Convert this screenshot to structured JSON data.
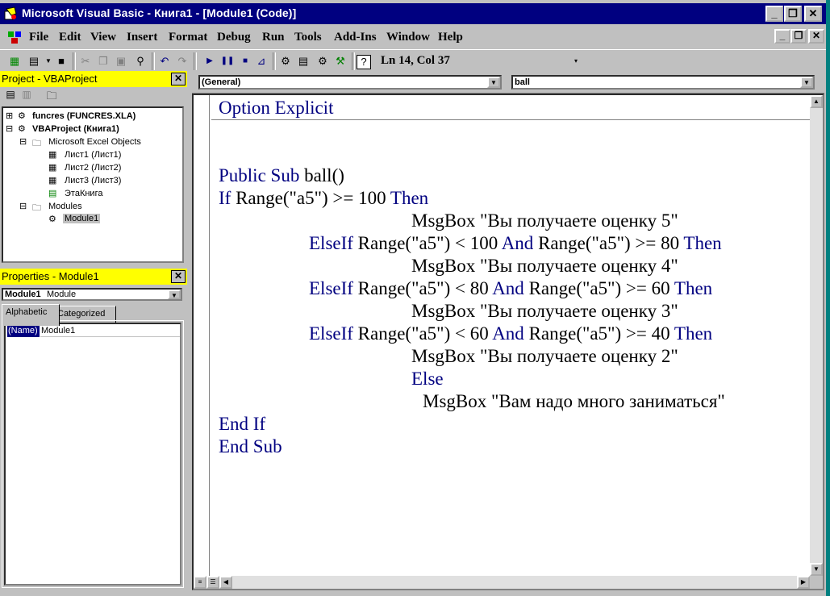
{
  "window": {
    "title": "Microsoft Visual Basic - Книга1 - [Module1 (Code)]"
  },
  "menu": [
    "File",
    "Edit",
    "View",
    "Insert",
    "Format",
    "Debug",
    "Run",
    "Tools",
    "Add-Ins",
    "Window",
    "Help"
  ],
  "toolbar": {
    "position": "Ln 14, Col 37"
  },
  "project_pane": {
    "title": "Project - VBAProject",
    "nodes": {
      "funcres": "funcres (FUNCRES.XLA)",
      "vbaproject": "VBAProject (Книга1)",
      "excel_objects": "Microsoft Excel Objects",
      "sheet1": "Лист1 (Лист1)",
      "sheet2": "Лист2 (Лист2)",
      "sheet3": "Лист3 (Лист3)",
      "thisbook": "ЭтаКнига",
      "modules": "Modules",
      "module1": "Module1"
    }
  },
  "properties_pane": {
    "title": "Properties - Module1",
    "object_name": "Module1",
    "object_type": "Module",
    "tabs": [
      "Alphabetic",
      "Categorized"
    ],
    "row": {
      "name": "(Name)",
      "value": "Module1"
    }
  },
  "editor": {
    "object_combo": "(General)",
    "proc_combo": "ball",
    "option_line": "Option Explicit",
    "lines": [
      {
        "indent": 0,
        "parts": [
          {
            "t": "Public Sub",
            "k": true
          },
          {
            "t": " ball()",
            "k": false
          }
        ]
      },
      {
        "indent": 0,
        "parts": [
          {
            "t": "If",
            "k": true
          },
          {
            "t": " Range(\"a5\") >= 100 ",
            "k": false
          },
          {
            "t": "Then",
            "k": true
          }
        ]
      },
      {
        "indent": 2,
        "parts": [
          {
            "t": "MsgBox \"Вы получаете оценку 5\"",
            "k": false
          }
        ]
      },
      {
        "indent": 1,
        "parts": [
          {
            "t": "ElseIf",
            "k": true
          },
          {
            "t": " Range(\"a5\") < 100 ",
            "k": false
          },
          {
            "t": "And",
            "k": true
          },
          {
            "t": " Range(\"a5\") >= 80 ",
            "k": false
          },
          {
            "t": "Then",
            "k": true
          }
        ]
      },
      {
        "indent": 2,
        "parts": [
          {
            "t": "MsgBox \"Вы получаете оценку 4\"",
            "k": false
          }
        ]
      },
      {
        "indent": 1,
        "parts": [
          {
            "t": "ElseIf",
            "k": true
          },
          {
            "t": " Range(\"a5\") < 80 ",
            "k": false
          },
          {
            "t": "And",
            "k": true
          },
          {
            "t": " Range(\"a5\") >= 60 ",
            "k": false
          },
          {
            "t": "Then",
            "k": true
          }
        ]
      },
      {
        "indent": 2,
        "parts": [
          {
            "t": "MsgBox \"Вы получаете оценку 3\"",
            "k": false
          }
        ]
      },
      {
        "indent": 1,
        "parts": [
          {
            "t": "ElseIf",
            "k": true
          },
          {
            "t": " Range(\"a5\") < 60 ",
            "k": false
          },
          {
            "t": "And",
            "k": true
          },
          {
            "t": " Range(\"a5\") >= 40 ",
            "k": false
          },
          {
            "t": "Then",
            "k": true
          }
        ]
      },
      {
        "indent": 2,
        "parts": [
          {
            "t": "MsgBox \"Вы получаете оценку 2\"",
            "k": false
          }
        ]
      },
      {
        "indent": 2,
        "parts": [
          {
            "t": "Else",
            "k": true
          }
        ]
      },
      {
        "indent": 3,
        "parts": [
          {
            "t": "MsgBox \"Вам надо много заниматься\"",
            "k": false
          }
        ]
      },
      {
        "indent": 0,
        "parts": [
          {
            "t": "End If",
            "k": true
          }
        ]
      },
      {
        "indent": 0,
        "parts": [
          {
            "t": "End Sub",
            "k": true
          }
        ]
      }
    ]
  }
}
